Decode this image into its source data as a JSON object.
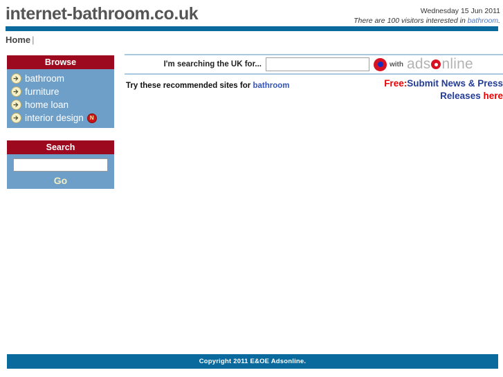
{
  "header": {
    "site_title": "internet-bathroom.co.uk",
    "date": "Wednesday 15 Jun 2011",
    "visitors_prefix": "There are 100 visitors interested in ",
    "visitors_keyword": "bathroom",
    "visitors_suffix": ".",
    "accent_blue": "#0a6a9e"
  },
  "nav": {
    "home_label": "Home",
    "separator": "|"
  },
  "sidebar": {
    "browse": {
      "title": "Browse",
      "items": [
        {
          "label": "bathroom",
          "icon": "arrow-right-icon",
          "badge": ""
        },
        {
          "label": "furniture",
          "icon": "arrow-right-icon",
          "badge": ""
        },
        {
          "label": "home loan",
          "icon": "arrow-right-icon",
          "badge": ""
        },
        {
          "label": "interior design",
          "icon": "arrow-right-icon",
          "badge": "N"
        }
      ],
      "header_color": "#9d0a20",
      "body_color": "#6e9fc8"
    },
    "search": {
      "title": "Search",
      "input_value": "",
      "input_placeholder": "",
      "go_label": "Go"
    }
  },
  "main": {
    "search_prompt": "I'm searching the UK for...",
    "search_value": "",
    "search_placeholder": "",
    "target_icon": "bullseye-icon",
    "with_label": "with",
    "logo": {
      "part1": "ads",
      "part_o": "o",
      "part2": "nline"
    },
    "recommended_prefix": "Try these recommended sites for ",
    "recommended_keyword": "bathroom",
    "promo": {
      "free": "Free:",
      "line1": "Submit News & Press",
      "line2": "Releases ",
      "here": "here"
    }
  },
  "footer": {
    "copyright": "Copyright 2011 E&OE Adsonline."
  }
}
